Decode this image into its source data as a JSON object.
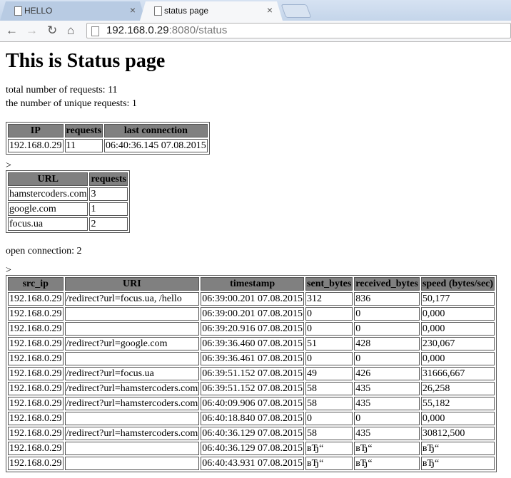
{
  "browser": {
    "tabs": [
      {
        "title": "HELLO",
        "close": "×"
      },
      {
        "title": "status page",
        "close": "×"
      }
    ],
    "address": {
      "host": "192.168.0.29",
      "rest": ":8080/status"
    }
  },
  "page": {
    "heading": "This is Status page",
    "total_requests": "total number of requests: 11",
    "unique_requests": "the number of unique requests: 1",
    "ip_table": {
      "headers": [
        "IP",
        "requests",
        "last connection"
      ],
      "rows": [
        [
          "192.168.0.29",
          "11",
          "06:40:36.145 07.08.2015"
        ]
      ]
    },
    "separator1": ">",
    "url_table": {
      "headers": [
        "URL",
        "requests"
      ],
      "rows": [
        [
          "hamstercoders.com",
          "3"
        ],
        [
          "google.com",
          "1"
        ],
        [
          "focus.ua",
          "2"
        ]
      ]
    },
    "open_connections": "open connection: 2",
    "separator2": ">",
    "log_table": {
      "headers": [
        "src_ip",
        "URI",
        "timestamp",
        "sent_bytes",
        "received_bytes",
        "speed (bytes/sec)"
      ],
      "rows": [
        [
          "192.168.0.29",
          "/redirect?url=focus.ua, /hello",
          "06:39:00.201 07.08.2015",
          "312",
          "836",
          "50,177"
        ],
        [
          "192.168.0.29",
          "",
          "06:39:00.201 07.08.2015",
          "0",
          "0",
          "0,000"
        ],
        [
          "192.168.0.29",
          "",
          "06:39:20.916 07.08.2015",
          "0",
          "0",
          "0,000"
        ],
        [
          "192.168.0.29",
          "/redirect?url=google.com",
          "06:39:36.460 07.08.2015",
          "51",
          "428",
          "230,067"
        ],
        [
          "192.168.0.29",
          "",
          "06:39:36.461 07.08.2015",
          "0",
          "0",
          "0,000"
        ],
        [
          "192.168.0.29",
          "/redirect?url=focus.ua",
          "06:39:51.152 07.08.2015",
          "49",
          "426",
          "31666,667"
        ],
        [
          "192.168.0.29",
          "/redirect?url=hamstercoders.com",
          "06:39:51.152 07.08.2015",
          "58",
          "435",
          "26,258"
        ],
        [
          "192.168.0.29",
          "/redirect?url=hamstercoders.com",
          "06:40:09.906 07.08.2015",
          "58",
          "435",
          "55,182"
        ],
        [
          "192.168.0.29",
          "",
          "06:40:18.840 07.08.2015",
          "0",
          "0",
          "0,000"
        ],
        [
          "192.168.0.29",
          "/redirect?url=hamstercoders.com",
          "06:40:36.129 07.08.2015",
          "58",
          "435",
          "30812,500"
        ],
        [
          "192.168.0.29",
          "",
          "06:40:36.129 07.08.2015",
          "вЂ“",
          "вЂ“",
          "вЂ“"
        ],
        [
          "192.168.0.29",
          "",
          "06:40:43.931 07.08.2015",
          "вЂ“",
          "вЂ“",
          "вЂ“"
        ]
      ]
    }
  }
}
